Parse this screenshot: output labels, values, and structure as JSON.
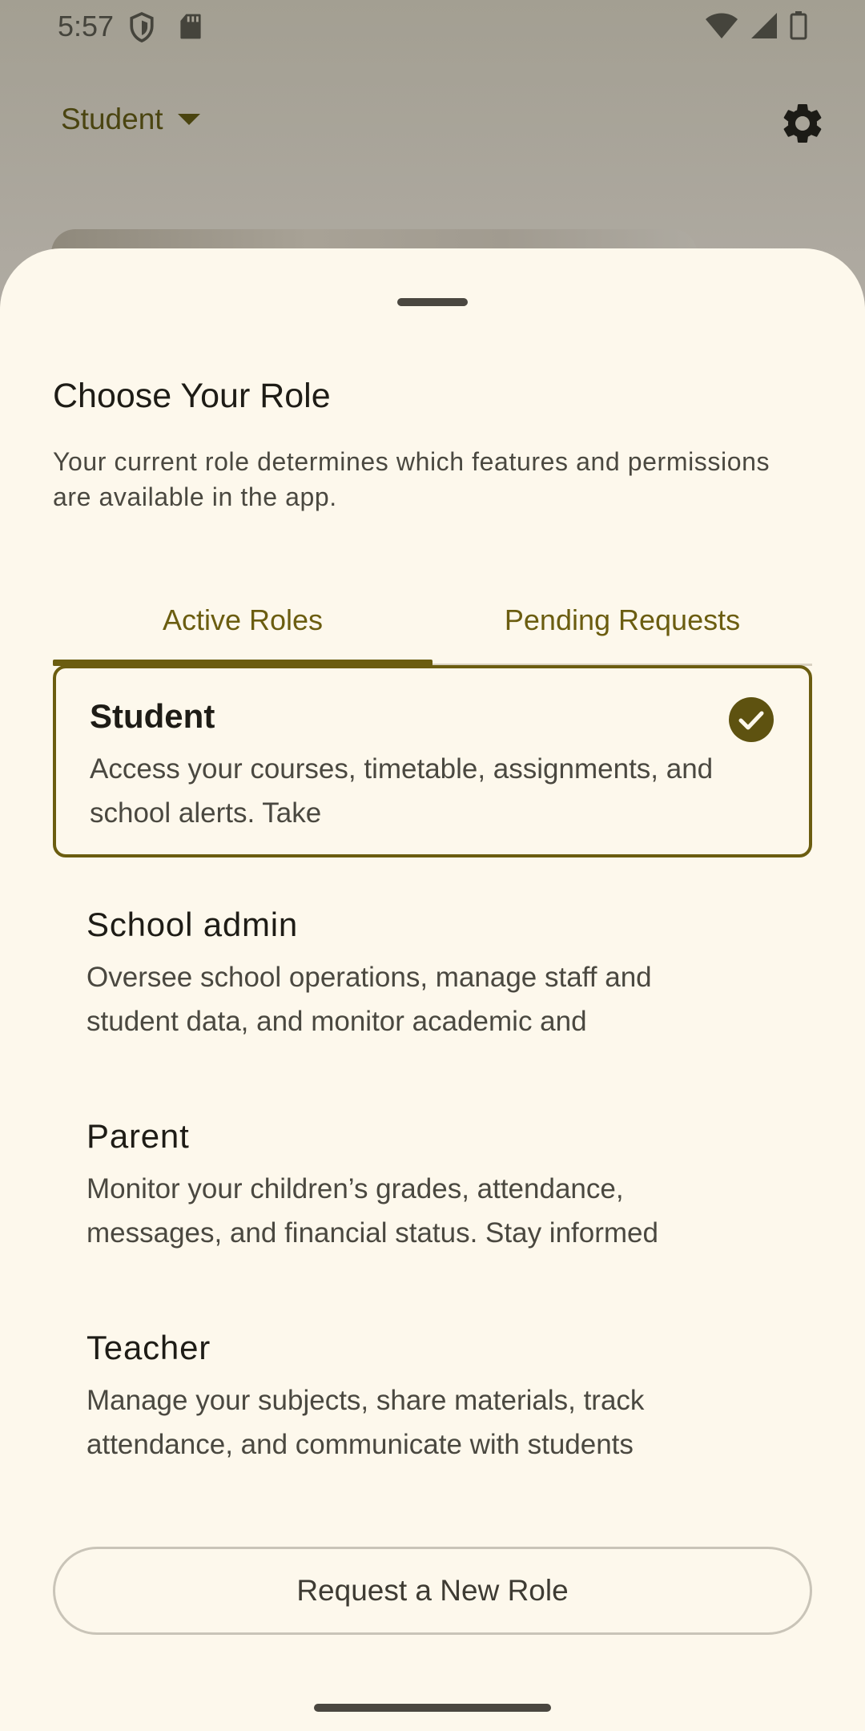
{
  "status_bar": {
    "time": "5:57",
    "icons": [
      "shield-icon",
      "sd-card-icon",
      "wifi-icon",
      "cell-signal-icon",
      "battery-icon"
    ]
  },
  "app_bar": {
    "role_label": "Student",
    "settings_icon": "gear-icon"
  },
  "sheet": {
    "title": "Choose Your Role",
    "description": "Your current role determines which features and permissions are available in the app.",
    "tabs": [
      {
        "label": "Active Roles",
        "active": true
      },
      {
        "label": "Pending Requests",
        "active": false
      }
    ],
    "roles": [
      {
        "name": "Student",
        "description": "Access your courses, timetable, assignments, and school alerts. Take",
        "selected": true
      },
      {
        "name": "School admin",
        "description": "Oversee school operations, manage staff and student data, and monitor academic and",
        "selected": false
      },
      {
        "name": "Parent",
        "description": "Monitor your children’s grades, attendance, messages, and financial status. Stay informed",
        "selected": false
      },
      {
        "name": "Teacher",
        "description": "Manage your subjects, share materials, track attendance, and communicate with students",
        "selected": false
      }
    ],
    "request_button_label": "Request a New Role"
  },
  "colors": {
    "accent": "#6b5d10",
    "sheet_background": "#fdf8ec",
    "scrim": "#aeaaa1"
  }
}
